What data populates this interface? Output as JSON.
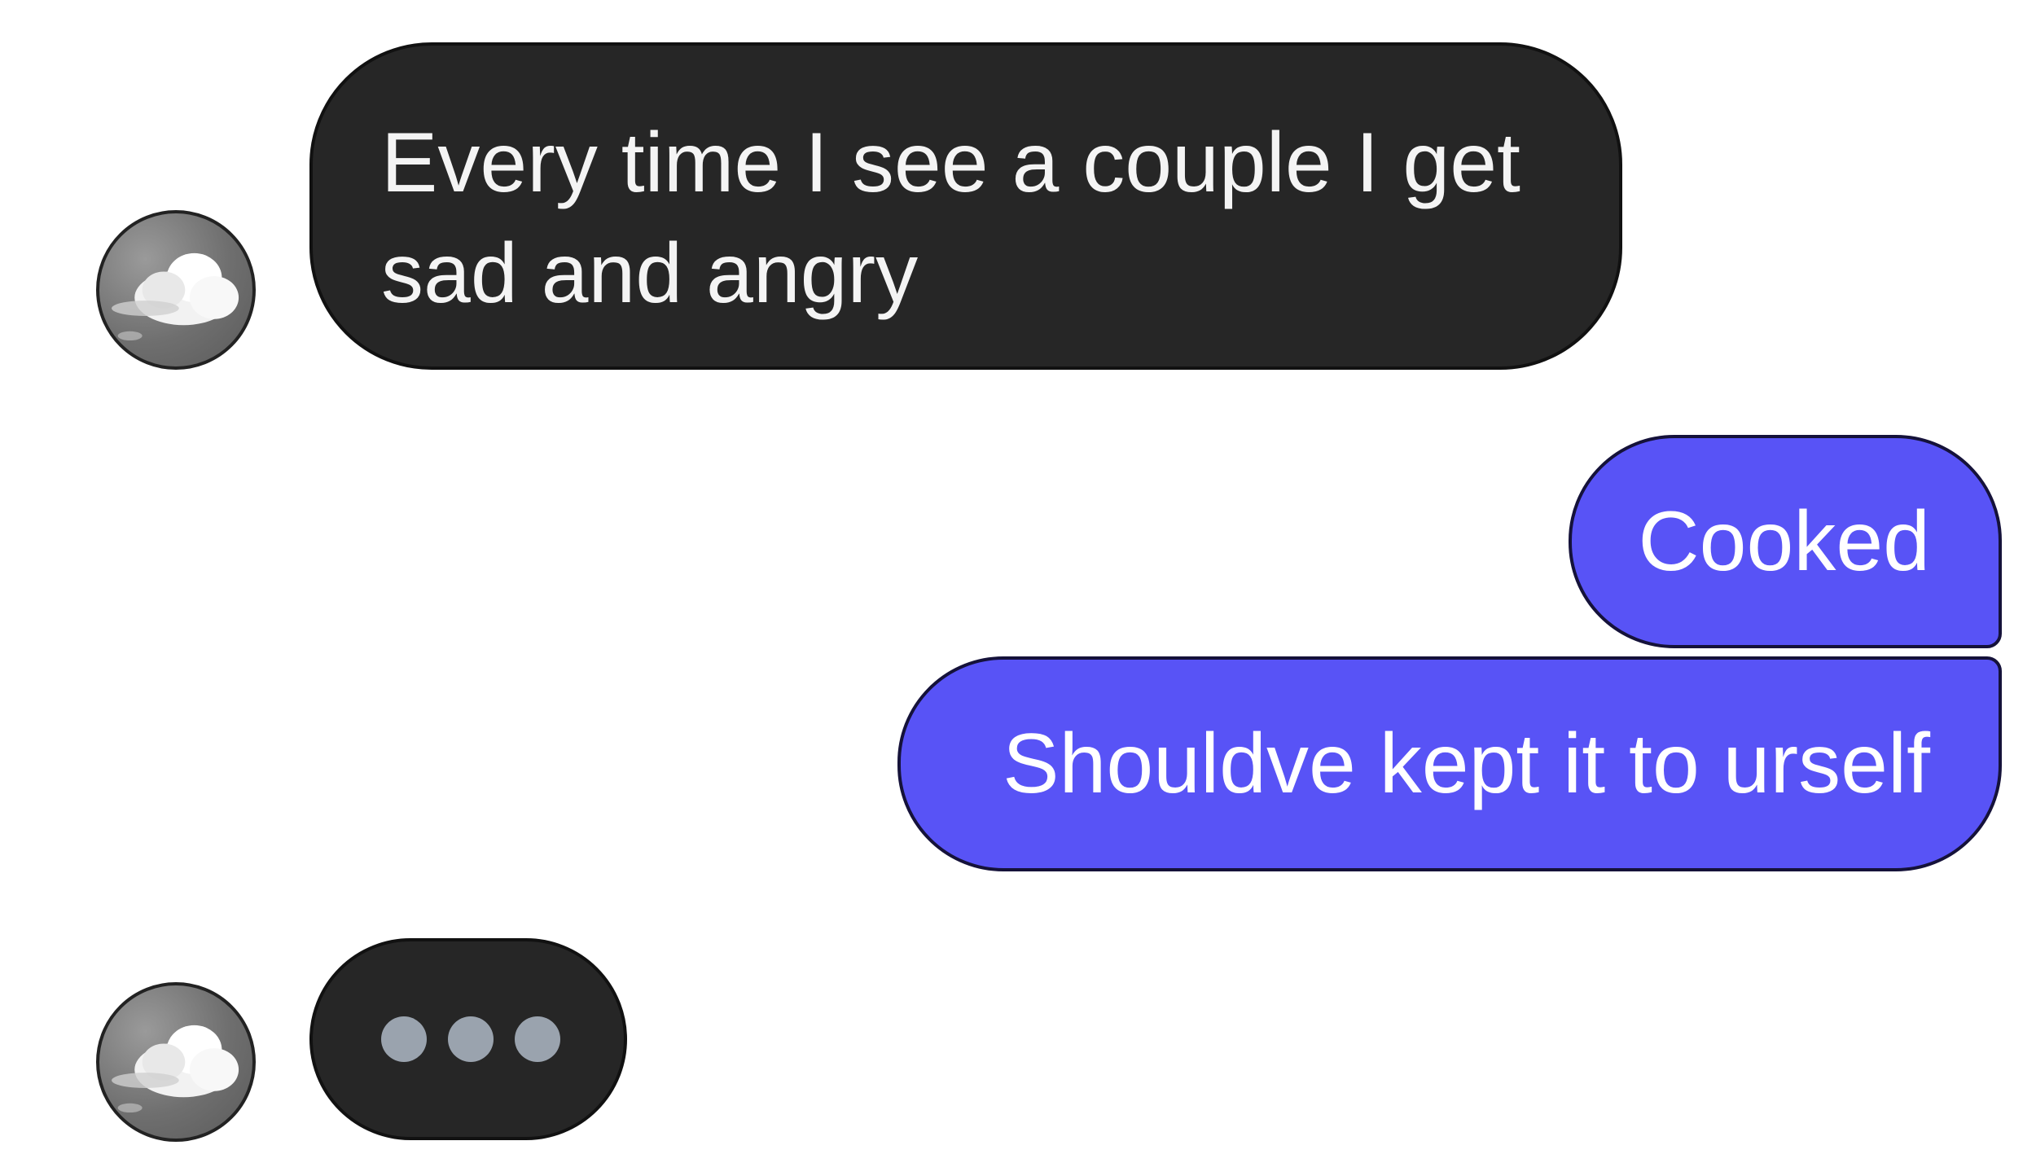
{
  "conversation": {
    "messages": [
      {
        "sender": "contact",
        "text": "Every time I see a couple I get\nsad and angry"
      },
      {
        "sender": "me",
        "text": "Cooked"
      },
      {
        "sender": "me",
        "text": "Shouldve kept it to urself"
      }
    ],
    "typing_indicator": {
      "sender": "contact",
      "dot_count": 3
    }
  },
  "colors": {
    "incoming_bubble": "#262626",
    "outgoing_bubble": "#5853f6",
    "bubble_text": "#f4f4f4",
    "typing_dot": "#9aa3ae",
    "background": "#ffffff"
  },
  "icons": {
    "avatar": "cloud-avatar-icon"
  }
}
